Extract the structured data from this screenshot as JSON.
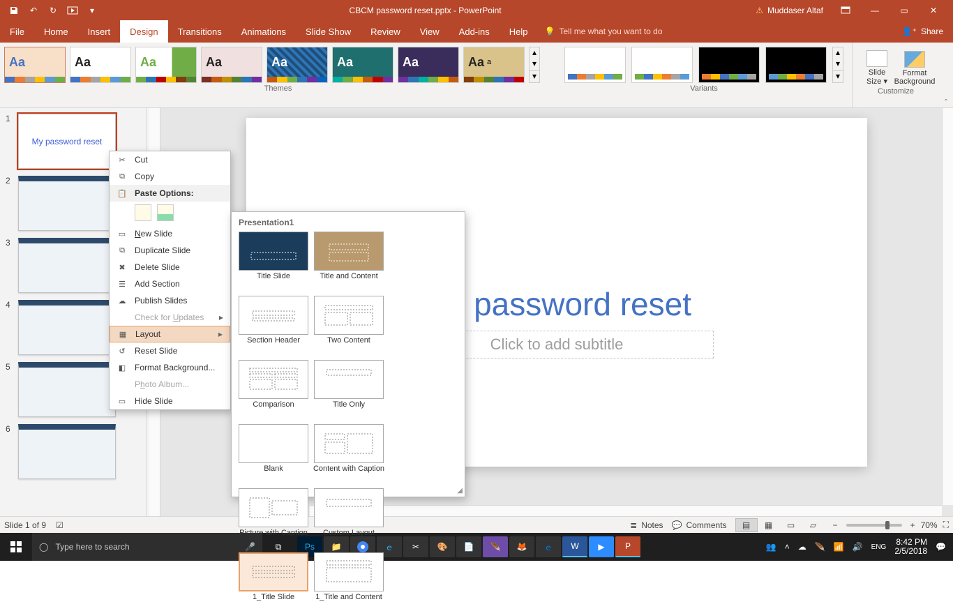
{
  "title": {
    "filename": "CBCM password reset.pptx",
    "app": "PowerPoint",
    "full": "CBCM password reset.pptx  -  PowerPoint"
  },
  "user": {
    "name": "Muddaser Altaf"
  },
  "tabs": {
    "file": "File",
    "home": "Home",
    "insert": "Insert",
    "design": "Design",
    "transitions": "Transitions",
    "animations": "Animations",
    "slideshow": "Slide Show",
    "review": "Review",
    "view": "View",
    "addins": "Add-ins",
    "help": "Help",
    "tell": "Tell me what you want to do",
    "share": "Share"
  },
  "ribbon": {
    "themes_label": "Themes",
    "variants_label": "Variants",
    "customize_label": "Customize",
    "slide_size": "Slide\nSize ▾",
    "format_bg": "Format\nBackground"
  },
  "thumbs": {
    "nums": [
      "1",
      "2",
      "3",
      "4",
      "5",
      "6"
    ],
    "slide1_text": "My password reset"
  },
  "slide": {
    "title": "My password reset",
    "subtitle_placeholder": "Click to add subtitle"
  },
  "context_menu": {
    "cut": "Cut",
    "copy": "Copy",
    "paste_header": "Paste Options:",
    "new_slide": "New Slide",
    "duplicate": "Duplicate Slide",
    "delete": "Delete Slide",
    "add_section": "Add Section",
    "publish": "Publish Slides",
    "check_updates": "Check for Updates",
    "layout": "Layout",
    "reset": "Reset Slide",
    "format_bg": "Format Background...",
    "photo_album": "Photo Album...",
    "hide_slide": "Hide Slide"
  },
  "layout_flyout": {
    "header": "Presentation1",
    "items": [
      "Title Slide",
      "Title and Content",
      "Section Header",
      "Two Content",
      "Comparison",
      "Title Only",
      "Blank",
      "Content with Caption",
      "Picture with Caption",
      "Custom Layout",
      "1_Title Slide",
      "1_Title and Content"
    ]
  },
  "status": {
    "slide_counter": "Slide 1 of 9",
    "notes": "Notes",
    "comments": "Comments",
    "zoom": "70%"
  },
  "taskbar": {
    "search_placeholder": "Type here to search",
    "time": "8:42 PM",
    "date": "2/5/2018"
  }
}
